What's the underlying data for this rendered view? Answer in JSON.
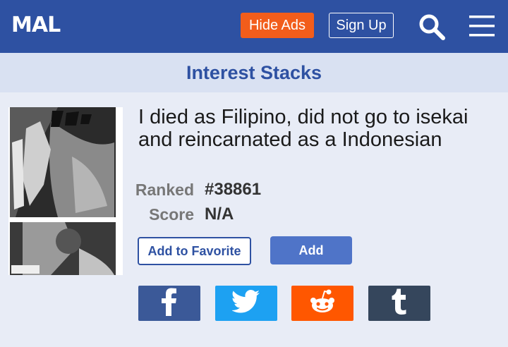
{
  "header": {
    "logo_text": "MAL",
    "hide_ads_label": "Hide Ads",
    "sign_up_label": "Sign Up",
    "search_icon": "search-icon",
    "menu_icon": "hamburger-menu-icon",
    "brand_color": "#2e51a2",
    "accent_color": "#f25d1b"
  },
  "section": {
    "title": "Interest Stacks"
  },
  "manga": {
    "title": "I died as Filipino, did not go to isekai and reincarnated as a Indonesian",
    "ranked_label": "Ranked",
    "ranked_value": "#38861",
    "score_label": "Score",
    "score_value": "N/A"
  },
  "actions": {
    "favorite_label": "Add to Favorite",
    "add_label": "Add"
  },
  "share": [
    {
      "name": "facebook",
      "icon": "facebook-icon",
      "color": "#3b5998"
    },
    {
      "name": "twitter",
      "icon": "twitter-icon",
      "color": "#1da1f2"
    },
    {
      "name": "reddit",
      "icon": "reddit-icon",
      "color": "#ff5700"
    },
    {
      "name": "tumblr",
      "icon": "tumblr-icon",
      "color": "#35465c"
    }
  ]
}
